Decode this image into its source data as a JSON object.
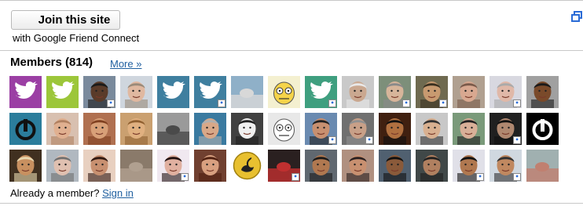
{
  "join": {
    "button_label": "Join this site",
    "subtitle": "with Google Friend Connect"
  },
  "members": {
    "heading": "Members (814)",
    "more_link": "More »"
  },
  "footer": {
    "prompt": "Already a member?",
    "signin_link": "Sign in"
  },
  "colors": {
    "link": "#1f5f9f",
    "rule": "#c8c8c8"
  },
  "avatars": [
    {
      "kind": "bird",
      "bg": "#9b3fa4",
      "fg": "#ffffff",
      "badge": false
    },
    {
      "kind": "bird",
      "bg": "#9cc63a",
      "fg": "#ffffff",
      "badge": false
    },
    {
      "kind": "face",
      "bg": "#7a8a9c",
      "skin": "#5a3b2a",
      "hair": "#1a1a1a",
      "badge": true
    },
    {
      "kind": "face",
      "bg": "#cfd6de",
      "skin": "#e0b8a0",
      "hair": "#9a8a7a",
      "badge": false
    },
    {
      "kind": "bird",
      "bg": "#3f7f9f",
      "fg": "#ffffff",
      "badge": false
    },
    {
      "kind": "bird",
      "bg": "#3f7f9f",
      "fg": "#ffffff",
      "badge": true
    },
    {
      "kind": "scene",
      "bg": "#8fb0c8",
      "fg": "#d8d8d8",
      "badge": false
    },
    {
      "kind": "cartoon",
      "bg": "#f4f0d0",
      "fg": "#f5d44a",
      "badge": false
    },
    {
      "kind": "bird",
      "bg": "#3f9f7f",
      "fg": "#ffffff",
      "badge": true
    },
    {
      "kind": "face",
      "bg": "#c9c9c9",
      "skin": "#caa890",
      "hair": "#e8e8e8",
      "badge": false
    },
    {
      "kind": "face",
      "bg": "#7d8f7a",
      "skin": "#d7b59a",
      "hair": "#8a8a8a",
      "badge": true
    },
    {
      "kind": "face",
      "bg": "#6f6a50",
      "skin": "#c89a70",
      "hair": "#3a3020",
      "badge": true
    },
    {
      "kind": "face",
      "bg": "#b0a090",
      "skin": "#d8a890",
      "hair": "#7a5a4a",
      "badge": false
    },
    {
      "kind": "face",
      "bg": "#d8d8e0",
      "skin": "#e0b8a8",
      "hair": "#aaaaaa",
      "badge": true
    },
    {
      "kind": "face",
      "bg": "#a0a0a0",
      "skin": "#7a4a2a",
      "hair": "#1a1a1a",
      "badge": false
    },
    {
      "kind": "logo",
      "bg": "#2b7d9c",
      "fg": "#111111",
      "badge": false
    },
    {
      "kind": "face",
      "bg": "#d8c0b0",
      "skin": "#e0b090",
      "hair": "#b08060",
      "badge": false
    },
    {
      "kind": "face",
      "bg": "#b07050",
      "skin": "#d8a078",
      "hair": "#804020",
      "badge": false
    },
    {
      "kind": "face",
      "bg": "#caa070",
      "skin": "#e0b080",
      "hair": "#906030",
      "badge": false
    },
    {
      "kind": "scene",
      "bg": "#9a9a9a",
      "fg": "#4a4a4a",
      "badge": false
    },
    {
      "kind": "face",
      "bg": "#3a7aa0",
      "skin": "#d8a888",
      "hair": "#b0b0b0",
      "badge": false
    },
    {
      "kind": "face",
      "bg": "#404040",
      "skin": "#f0f0f0",
      "hair": "#202020",
      "badge": false
    },
    {
      "kind": "cartoon",
      "bg": "#e8e8e8",
      "fg": "#ffffff",
      "badge": false
    },
    {
      "kind": "face",
      "bg": "#6a8ab0",
      "skin": "#c89070",
      "hair": "#202020",
      "badge": true
    },
    {
      "kind": "face",
      "bg": "#707070",
      "skin": "#c8a088",
      "hair": "#909090",
      "badge": true
    },
    {
      "kind": "face",
      "bg": "#402010",
      "skin": "#b07040",
      "hair": "#101010",
      "badge": false
    },
    {
      "kind": "face",
      "bg": "#c8c8c8",
      "skin": "#d8b090",
      "hair": "#303030",
      "badge": false
    },
    {
      "kind": "face",
      "bg": "#7a9a7a",
      "skin": "#d8b098",
      "hair": "#202020",
      "badge": false
    },
    {
      "kind": "face",
      "bg": "#202020",
      "skin": "#b08870",
      "hair": "#101010",
      "badge": true
    },
    {
      "kind": "logo",
      "bg": "#000000",
      "fg": "#ffffff",
      "badge": false
    },
    {
      "kind": "face",
      "bg": "#403020",
      "skin": "#c89060",
      "hair": "#e8d8b0",
      "badge": false
    },
    {
      "kind": "face",
      "bg": "#b0b8c0",
      "skin": "#e0c0b0",
      "hair": "#707070",
      "badge": false
    },
    {
      "kind": "face",
      "bg": "#e8d0c0",
      "skin": "#c89070",
      "hair": "#301810",
      "badge": false
    },
    {
      "kind": "scene",
      "bg": "#8a7a6a",
      "fg": "#b0a090",
      "badge": false
    },
    {
      "kind": "face",
      "bg": "#f0e8f0",
      "skin": "#e0b0a0",
      "hair": "#201010",
      "badge": true
    },
    {
      "kind": "face",
      "bg": "#704030",
      "skin": "#d8a080",
      "hair": "#502010",
      "badge": false
    },
    {
      "kind": "coin",
      "bg": "#ffffff",
      "fg": "#e8c030",
      "badge": false
    },
    {
      "kind": "scene",
      "bg": "#2a2020",
      "fg": "#c03030",
      "badge": true
    },
    {
      "kind": "face",
      "bg": "#606870",
      "skin": "#b07850",
      "hair": "#1a1a1a",
      "badge": false
    },
    {
      "kind": "face",
      "bg": "#b09080",
      "skin": "#c89070",
      "hair": "#2a2020",
      "badge": false
    },
    {
      "kind": "face",
      "bg": "#506070",
      "skin": "#8a5a3a",
      "hair": "#101010",
      "badge": false
    },
    {
      "kind": "face",
      "bg": "#404848",
      "skin": "#b08060",
      "hair": "#202020",
      "badge": false
    },
    {
      "kind": "face",
      "bg": "#e0e0e8",
      "skin": "#b07850",
      "hair": "#101010",
      "badge": true
    },
    {
      "kind": "face",
      "bg": "#d0d8e0",
      "skin": "#c08860",
      "hair": "#303030",
      "badge": true
    },
    {
      "kind": "scene",
      "bg": "#a0b0b0",
      "fg": "#c08070",
      "badge": false
    }
  ]
}
